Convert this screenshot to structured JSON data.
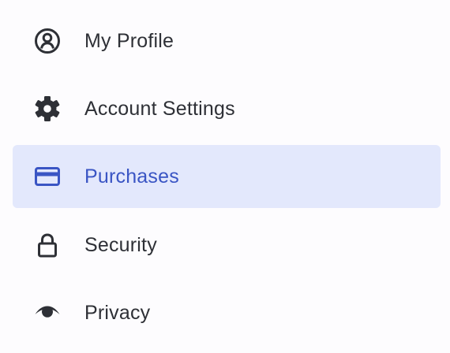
{
  "menu": {
    "items": [
      {
        "label": "My Profile",
        "icon": "profile-icon",
        "active": false
      },
      {
        "label": "Account Settings",
        "icon": "gear-icon",
        "active": false
      },
      {
        "label": "Purchases",
        "icon": "credit-card-icon",
        "active": true
      },
      {
        "label": "Security",
        "icon": "lock-icon",
        "active": false
      },
      {
        "label": "Privacy",
        "icon": "eye-icon",
        "active": false
      }
    ]
  },
  "colors": {
    "background": "#fdfcfe",
    "text": "#2e3036",
    "active_background": "#e3e8fc",
    "active_text": "#3a55c4"
  }
}
